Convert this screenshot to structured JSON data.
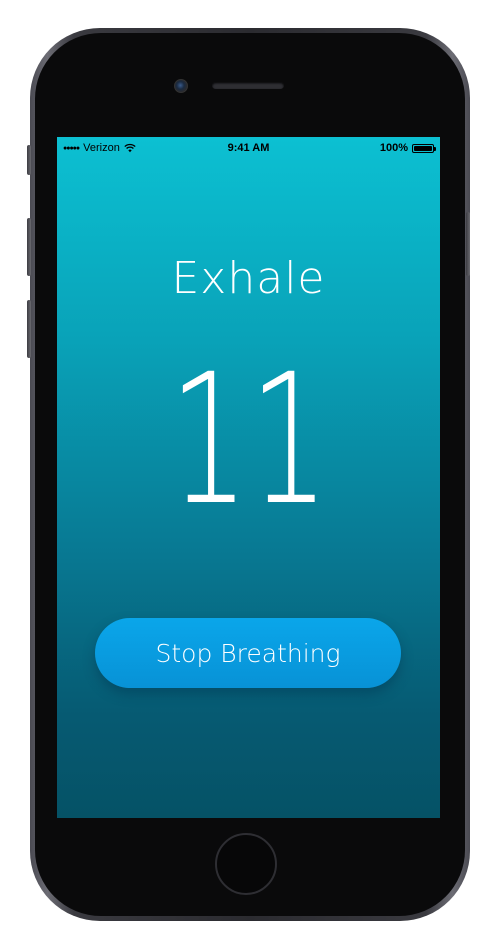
{
  "status_bar": {
    "signal": "●●●●●",
    "carrier": "Verizon",
    "time": "9:41 AM",
    "battery_percent": "100%",
    "battery_level": 1.0,
    "icons": [
      "wifi-icon",
      "battery-icon"
    ]
  },
  "main": {
    "phase_label": "Exhale",
    "counter": "11",
    "stop_button_label": "Stop Breathing"
  },
  "colors": {
    "screen_top": "#0cc0d2",
    "screen_bottom": "#055266",
    "button": "#0aa6ea",
    "text": "#ffffff"
  }
}
